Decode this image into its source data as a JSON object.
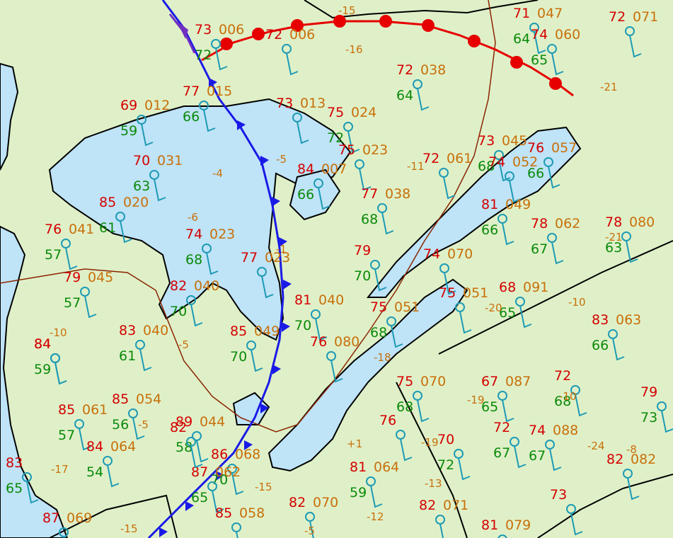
{
  "map": {
    "colors": {
      "land": "#dff0c8",
      "water": "#bfe3f7",
      "temperature": "#d40000",
      "dewpoint": "#0a8a0a",
      "pressure": "#c8700a",
      "station": "#1e9bb5",
      "cold_front": "#1a1ae6",
      "warm_front": "#e60000",
      "border": "#000000"
    },
    "fronts": [
      {
        "type": "cold-front",
        "color": "#1a1ae6"
      },
      {
        "type": "warm-front",
        "color": "#e60000"
      },
      {
        "type": "occluded-front",
        "color": "#7030c0"
      }
    ],
    "station_obs": [
      {
        "temp": "73",
        "pres": "006",
        "dew": "72"
      },
      {
        "temp": "72",
        "pres": "006",
        "dew": ""
      },
      {
        "temp": "71",
        "pres": "047",
        "dew": "64"
      },
      {
        "temp": "72",
        "pres": "071",
        "dew": ""
      },
      {
        "temp": "74",
        "pres": "060",
        "dew": "65"
      },
      {
        "temp": "72",
        "pres": "038",
        "dew": "64"
      },
      {
        "temp": "77",
        "pres": "015",
        "dew": "66"
      },
      {
        "temp": "69",
        "pres": "012",
        "dew": "59"
      },
      {
        "temp": "73",
        "pres": "013",
        "dew": ""
      },
      {
        "temp": "75",
        "pres": "024",
        "dew": "72"
      },
      {
        "temp": "75",
        "pres": "023",
        "dew": ""
      },
      {
        "temp": "70",
        "pres": "031",
        "dew": "63"
      },
      {
        "temp": "84",
        "pres": "007",
        "dew": "66"
      },
      {
        "temp": "73",
        "pres": "045",
        "dew": "68"
      },
      {
        "temp": "76",
        "pres": "057",
        "dew": "66"
      },
      {
        "temp": "72",
        "pres": "061",
        "dew": ""
      },
      {
        "temp": "74",
        "pres": "052",
        "dew": ""
      },
      {
        "temp": "77",
        "pres": "038",
        "dew": "68"
      },
      {
        "temp": "81",
        "pres": "049",
        "dew": "66"
      },
      {
        "temp": "85",
        "pres": "020",
        "dew": "61"
      },
      {
        "temp": "76",
        "pres": "041",
        "dew": "57"
      },
      {
        "temp": "74",
        "pres": "023",
        "dew": "68"
      },
      {
        "temp": "78",
        "pres": "062",
        "dew": "67"
      },
      {
        "temp": "78",
        "pres": "080",
        "dew": "63"
      },
      {
        "temp": "79",
        "pres": "",
        "dew": "70"
      },
      {
        "temp": "74",
        "pres": "070",
        "dew": ""
      },
      {
        "temp": "77",
        "pres": "023",
        "dew": ""
      },
      {
        "temp": "79",
        "pres": "045",
        "dew": "57"
      },
      {
        "temp": "82",
        "pres": "040",
        "dew": "70"
      },
      {
        "temp": "81",
        "pres": "040",
        "dew": "70"
      },
      {
        "temp": "75",
        "pres": "051",
        "dew": "68"
      },
      {
        "temp": "75",
        "pres": "051",
        "dew": ""
      },
      {
        "temp": "68",
        "pres": "091",
        "dew": "65"
      },
      {
        "temp": "83",
        "pres": "063",
        "dew": "66"
      },
      {
        "temp": "83",
        "pres": "040",
        "dew": "61"
      },
      {
        "temp": "84",
        "pres": "",
        "dew": "59"
      },
      {
        "temp": "85",
        "pres": "049",
        "dew": "70"
      },
      {
        "temp": "76",
        "pres": "080",
        "dew": ""
      },
      {
        "temp": "75",
        "pres": "070",
        "dew": "68"
      },
      {
        "temp": "67",
        "pres": "087",
        "dew": "65"
      },
      {
        "temp": "72",
        "pres": "",
        "dew": "68"
      },
      {
        "temp": "79",
        "pres": "",
        "dew": "73"
      },
      {
        "temp": "85",
        "pres": "054",
        "dew": "56"
      },
      {
        "temp": "85",
        "pres": "061",
        "dew": "57"
      },
      {
        "temp": "89",
        "pres": "044",
        "dew": "58"
      },
      {
        "temp": "84",
        "pres": "064",
        "dew": "54"
      },
      {
        "temp": "86",
        "pres": "068",
        "dew": "70"
      },
      {
        "temp": "81",
        "pres": "064",
        "dew": "59"
      },
      {
        "temp": "70",
        "pres": "",
        "dew": "72"
      },
      {
        "temp": "72",
        "pres": "",
        "dew": "67"
      },
      {
        "temp": "74",
        "pres": "088",
        "dew": "67"
      },
      {
        "temp": "82",
        "pres": "082",
        "dew": ""
      },
      {
        "temp": "87",
        "pres": "062",
        "dew": "65"
      },
      {
        "temp": "85",
        "pres": "058",
        "dew": ""
      },
      {
        "temp": "82",
        "pres": "070",
        "dew": ""
      },
      {
        "temp": "82",
        "pres": "071",
        "dew": ""
      },
      {
        "temp": "81",
        "pres": "079",
        "dew": "68"
      },
      {
        "temp": "73",
        "pres": "",
        "dew": ""
      },
      {
        "temp": "87",
        "pres": "069",
        "dew": ""
      },
      {
        "temp": "83",
        "pres": "",
        "dew": "65"
      },
      {
        "temp": "76",
        "pres": "",
        "dew": ""
      },
      {
        "temp": "84",
        "pres": "",
        "dew": ""
      },
      {
        "temp": "82",
        "pres": "",
        "dew": ""
      }
    ],
    "tendencies": [
      "-15",
      "-16",
      "-21",
      "-11",
      "-5",
      "-4",
      "-6",
      "-1",
      "-10",
      "-5",
      "-18",
      "-20",
      "-10",
      "-19",
      "-10",
      "-5",
      "-17",
      "-15",
      "-12",
      "-13",
      "-24",
      "-21",
      "-8",
      "-15",
      "+1",
      "-19",
      "-5"
    ]
  }
}
